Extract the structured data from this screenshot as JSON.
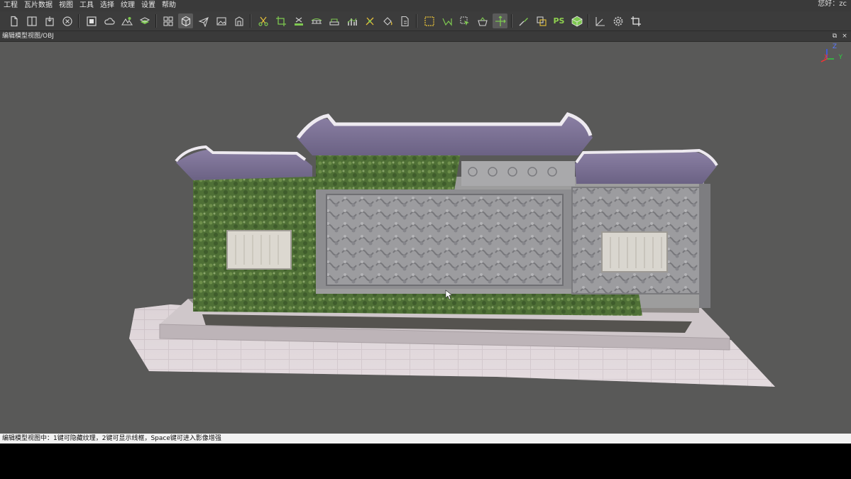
{
  "menu": {
    "items": [
      "工程",
      "瓦片数据",
      "视图",
      "工具",
      "选择",
      "纹理",
      "设置",
      "帮助"
    ],
    "greeting": "您好：zc"
  },
  "toolbar": {
    "buttons": [
      {
        "name": "new-file-icon"
      },
      {
        "name": "split-view-icon"
      },
      {
        "name": "export-icon"
      },
      {
        "name": "close-circle-icon"
      },
      {
        "name": "stop-square-icon"
      },
      {
        "name": "cloud-icon"
      },
      {
        "name": "terrain-icon"
      },
      {
        "name": "layers-icon"
      },
      {
        "name": "grid-icon"
      },
      {
        "name": "cube-icon"
      },
      {
        "name": "plane-icon"
      },
      {
        "name": "image-icon"
      },
      {
        "name": "building-icon"
      },
      {
        "name": "scissors-icon"
      },
      {
        "name": "crop-icon"
      },
      {
        "name": "flatten-icon"
      },
      {
        "name": "bridge-icon"
      },
      {
        "name": "road-icon"
      },
      {
        "name": "chart-icon"
      },
      {
        "name": "pin-icon"
      },
      {
        "name": "paint-bucket-icon"
      },
      {
        "name": "document-edit-icon"
      },
      {
        "name": "select-rect-icon"
      },
      {
        "name": "select-lasso-icon"
      },
      {
        "name": "select-cursor-icon"
      },
      {
        "name": "basket-icon"
      },
      {
        "name": "move-icon"
      },
      {
        "name": "texture-brush-icon"
      },
      {
        "name": "overlay-icon"
      },
      {
        "name": "photoshop-icon",
        "label": "PS"
      },
      {
        "name": "model-box-icon"
      },
      {
        "name": "axis-angle-icon"
      },
      {
        "name": "settings-gear-icon"
      },
      {
        "name": "frame-crop-icon"
      }
    ]
  },
  "view": {
    "title": "编辑模型视图/OBJ",
    "restore_label": "⧉",
    "close_label": "×",
    "axis": {
      "x": "X",
      "y": "Y",
      "z": "Z"
    }
  },
  "status": {
    "text": "编辑模型视图中：1键可隐藏纹理，2键可显示线框，Space键可进入影像增强"
  },
  "colors": {
    "viewport_bg": "#595958",
    "icon_green": "#7ec850",
    "icon_gray": "#cfcfcf",
    "icon_yellow": "#e8c23a"
  }
}
